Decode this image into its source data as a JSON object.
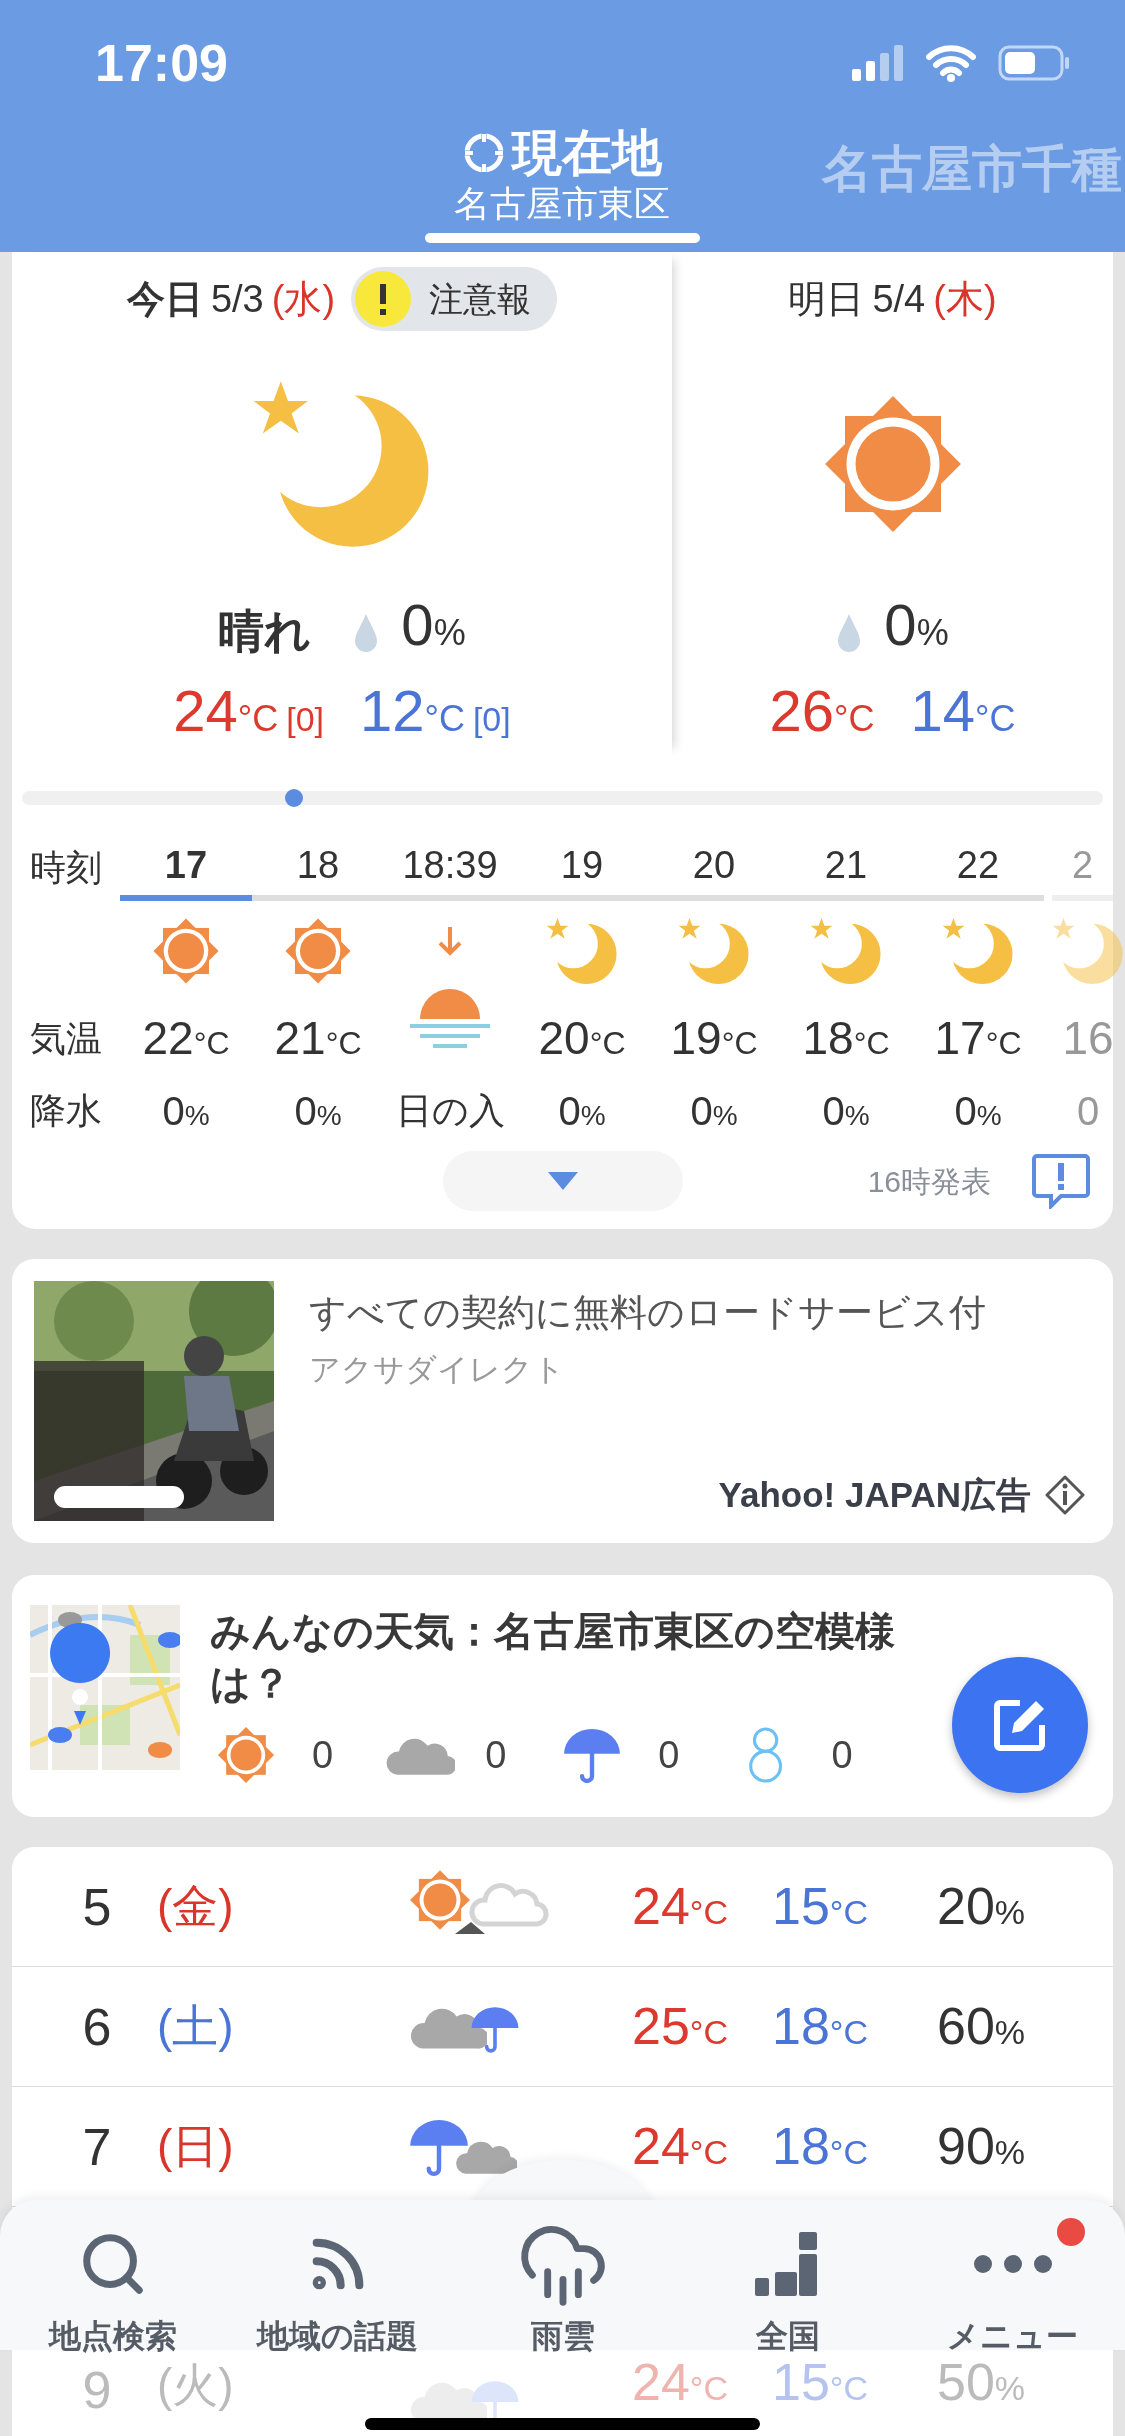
{
  "status_bar": {
    "time": "17:09"
  },
  "location_tabs": [
    {
      "title": "現在地",
      "subtitle": "名古屋市東区",
      "selected": true
    },
    {
      "title": "名古屋市千種",
      "selected": false
    }
  ],
  "forecast_days": [
    {
      "label": "今日",
      "date": "5/3",
      "weekday": "(水)",
      "color": "#d9352b",
      "alert": "注意報",
      "kind": "moon",
      "condition": "晴れ",
      "precip": "0",
      "precip_unit": "%",
      "high": "24",
      "high_unit": "°C",
      "high_note": "[0]",
      "low": "12",
      "low_unit": "°C",
      "low_note": "[0]"
    },
    {
      "label": "明日",
      "date": "5/4",
      "weekday": "(木)",
      "color": "#d9352b",
      "kind": "sun",
      "precip": "0",
      "precip_unit": "%",
      "high": "26",
      "high_unit": "°C",
      "low": "14",
      "low_unit": "°C"
    }
  ],
  "hourly": {
    "row_labels": [
      "時刻",
      "気温",
      "降水"
    ],
    "columns": [
      {
        "kind": "sun",
        "time": "17",
        "selected": true,
        "temp": "22",
        "temp_unit": "°C",
        "precip": "0",
        "precip_unit": "%"
      },
      {
        "kind": "sun",
        "time": "18",
        "selected": false,
        "temp": "21",
        "temp_unit": "°C",
        "precip": "0",
        "precip_unit": "%"
      },
      {
        "kind": "sunset",
        "time": "18:39",
        "selected": false,
        "note": "日の入"
      },
      {
        "kind": "moon",
        "time": "19",
        "selected": false,
        "temp": "20",
        "temp_unit": "°C",
        "precip": "0",
        "precip_unit": "%"
      },
      {
        "kind": "moon",
        "time": "20",
        "selected": false,
        "temp": "19",
        "temp_unit": "°C",
        "precip": "0",
        "precip_unit": "%"
      },
      {
        "kind": "moon",
        "time": "21",
        "selected": false,
        "temp": "18",
        "temp_unit": "°C",
        "precip": "0",
        "precip_unit": "%"
      },
      {
        "kind": "moon",
        "time": "22",
        "selected": false,
        "temp": "17",
        "temp_unit": "°C",
        "precip": "0",
        "precip_unit": "%"
      },
      {
        "kind": "moon",
        "time": "2",
        "selected": false,
        "temp": "16",
        "precip": "0"
      }
    ],
    "published": "16時発表"
  },
  "ad": {
    "title": "すべての契約に無料のロードサービス付",
    "advertiser": "アクサダイレクト",
    "label": "Yahoo! JAPAN広告"
  },
  "community": {
    "title": "みんなの天気：名古屋市東区の空模様は？",
    "counts": [
      {
        "kind": "sun",
        "count": "0"
      },
      {
        "kind": "cloud",
        "count": "0"
      },
      {
        "kind": "rain",
        "count": "0"
      },
      {
        "kind": "snow",
        "count": "0"
      }
    ]
  },
  "daily": [
    {
      "day": "5",
      "weekday": "(金)",
      "color": "#d9352b",
      "kind": "sun_later_cloud",
      "high": "24",
      "high_unit": "°C",
      "low": "15",
      "low_unit": "°C",
      "precip": "20",
      "precip_unit": "%"
    },
    {
      "day": "6",
      "weekday": "(土)",
      "color": "#4a74d6",
      "kind": "cloud_rain",
      "high": "25",
      "high_unit": "°C",
      "low": "18",
      "low_unit": "°C",
      "precip": "60",
      "precip_unit": "%"
    },
    {
      "day": "7",
      "weekday": "(日)",
      "color": "#d9352b",
      "kind": "rain_cloud",
      "high": "24",
      "high_unit": "°C",
      "low": "18",
      "low_unit": "°C",
      "precip": "90",
      "precip_unit": "%"
    },
    {
      "day": "9",
      "weekday": "(火)",
      "color": "#bbbbbb",
      "kind": "cloud_rain",
      "high": "24",
      "high_unit": "°C",
      "low": "15",
      "low_unit": "°C",
      "precip": "50",
      "precip_unit": "%"
    }
  ],
  "nav": [
    {
      "kind": "search",
      "label": "地点検索",
      "badge": false
    },
    {
      "kind": "topics",
      "label": "地域の話題",
      "badge": false
    },
    {
      "kind": "rain",
      "label": "雨雲",
      "badge": false
    },
    {
      "kind": "national",
      "label": "全国",
      "badge": false
    },
    {
      "kind": "menu",
      "label": "メニュー",
      "badge": true
    }
  ]
}
